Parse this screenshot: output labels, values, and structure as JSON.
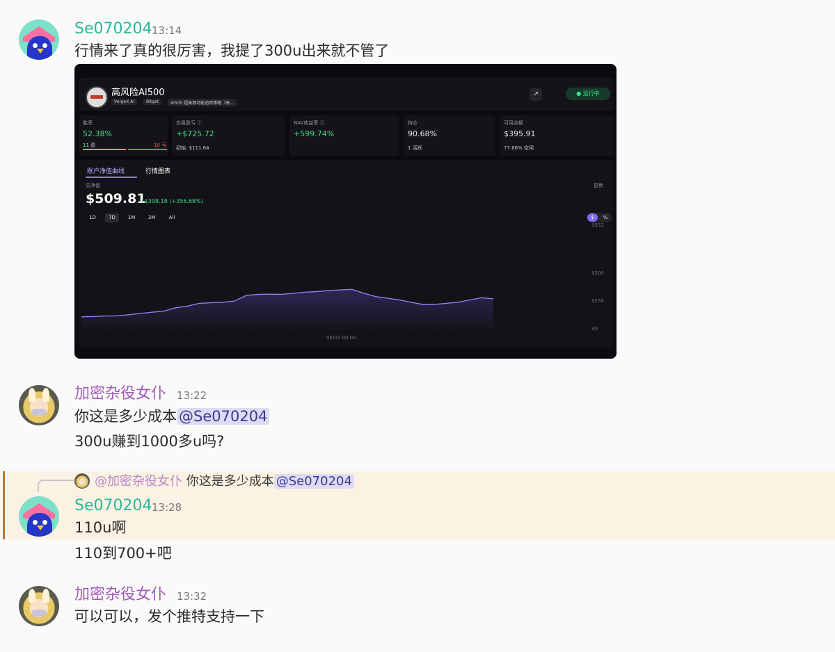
{
  "messages": [
    {
      "user": "Se070204",
      "time": "13:14",
      "lines": [
        "行情来了真的很厉害，我提了300u出来就不管了"
      ]
    },
    {
      "user": "加密杂役女仆",
      "time": "13:22",
      "lines": [
        "你这是多少成本",
        "300u赚到1000多u吗?"
      ],
      "mention": "@Se070204"
    },
    {
      "user": "Se070204",
      "time": "13:28",
      "lines": [
        "110u啊",
        "110到700+吧"
      ]
    },
    {
      "user": "加密杂役女仆",
      "time": "13:32",
      "lines": [
        "可以可以，发个推特支持一下"
      ]
    }
  ],
  "reply": {
    "name": "@加密杂役女仆",
    "text": "你这是多少成本",
    "mention": "@Se070204"
  },
  "screenshot": {
    "title": "高风险AI500",
    "tags": [
      "VergeX AI",
      "Bitget",
      "AI500 超高频动能追踪策略（高..."
    ],
    "status": "运行中",
    "stats": [
      {
        "label": "胜率",
        "value": "52.38%",
        "sub_left": "11 盈",
        "sub_right": "10 亏"
      },
      {
        "label": "交易盈亏 ⓘ",
        "value": "+$725.72",
        "sub": "初始: $111.64"
      },
      {
        "label": "NAV收益率 ⓘ",
        "value": "+599.74%"
      },
      {
        "label": "持仓",
        "value": "90.68%",
        "sub": "1 活跃"
      },
      {
        "label": "可用余额",
        "value": "$395.91",
        "sub": "77.66% 空闲"
      }
    ],
    "tab_nav": "账户净值曲线",
    "tab_market": "行情图表",
    "nav_label": "总净值",
    "refresh": "更新",
    "nav_value": "$509.81",
    "nav_change": "+$398.18 (+356.68%)",
    "ranges": [
      "1D",
      "7D",
      "1M",
      "3M",
      "All"
    ],
    "toggle": [
      "$",
      "%"
    ],
    "x_label": "06/02 00:00"
  },
  "chart_data": {
    "type": "area",
    "title": "",
    "ylabel": "",
    "y_ticks": [
      "$932",
      "$500",
      "$250",
      "$0"
    ],
    "ylim": [
      0,
      932
    ],
    "x_tick": "06/02 00:00",
    "values": [
      120,
      122,
      126,
      128,
      138,
      150,
      160,
      170,
      200,
      215,
      240,
      245,
      250,
      260,
      310,
      320,
      322,
      320,
      330,
      340,
      345,
      355,
      360,
      365,
      330,
      300,
      285,
      270,
      250,
      230,
      230,
      240,
      250,
      270,
      290,
      280
    ]
  },
  "colors": {
    "green_user": "#2bb79a",
    "purple_user": "#a05bb8",
    "accent_line": "#8e7cf0",
    "gain": "#3fdc8a"
  }
}
